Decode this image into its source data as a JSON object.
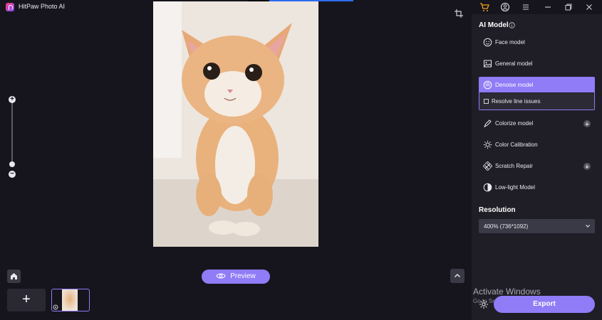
{
  "app": {
    "title": "HitPaw Photo AI"
  },
  "toolbar_icons": [
    "cart-icon",
    "account-icon",
    "menu-icon",
    "minimize-icon",
    "restore-icon",
    "close-icon"
  ],
  "colors": {
    "accent": "#8f7cf6",
    "background": "#16151d",
    "panel": "#1f1e27",
    "cart": "#f0a020"
  },
  "canvas": {
    "zoom_in": "+",
    "zoom_out": "−"
  },
  "bottom": {
    "preview_label": "Preview",
    "add_label": "+"
  },
  "panel": {
    "title": "AI Model",
    "models": [
      {
        "label": "Face model",
        "icon": "face-icon",
        "download": false
      },
      {
        "label": "General model",
        "icon": "image-icon",
        "download": false
      },
      {
        "label": "Denoise model",
        "icon": "denoise-icon",
        "selected": true,
        "download": false
      },
      {
        "label": "Colorize model",
        "icon": "brush-icon",
        "download": true
      },
      {
        "label": "Color Calibration",
        "icon": "sun-icon",
        "download": false
      },
      {
        "label": "Scratch Repair",
        "icon": "bandage-icon",
        "download": true
      },
      {
        "label": "Low-light Model",
        "icon": "contrast-icon",
        "download": false
      }
    ],
    "sub_option": {
      "label": "Resolve line issues",
      "checked": false
    },
    "resolution": {
      "title": "Resolution",
      "value": "400% (736*1092)"
    },
    "export_label": "Export"
  },
  "watermark": {
    "line1": "Activate Windows",
    "line2": "Go to Settings to activate Windows."
  }
}
